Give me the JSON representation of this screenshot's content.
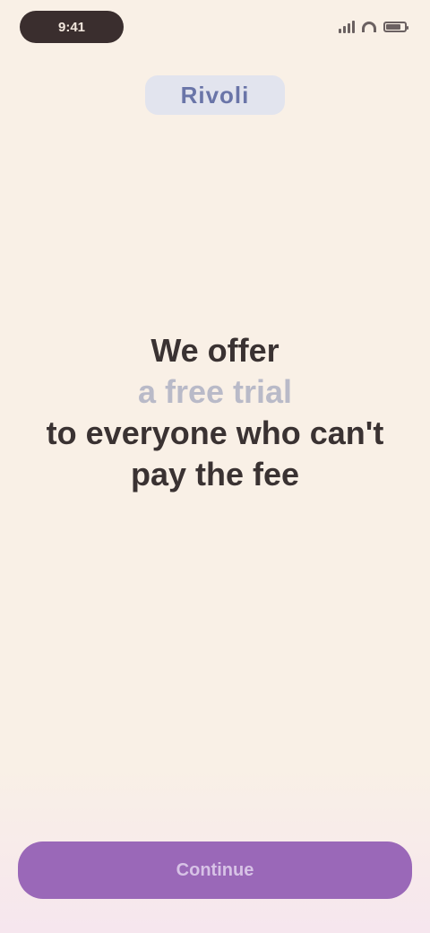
{
  "status_bar": {
    "time": "9:41",
    "icons": [
      "signal-icon",
      "wifi-icon",
      "battery-icon"
    ],
    "battery_level": 0.8
  },
  "logo": {
    "text": "Rivoli"
  },
  "message": {
    "line1": "We offer",
    "highlight": "a free trial",
    "line2": "to everyone who can't",
    "line3": "pay the fee"
  },
  "cta": {
    "label": "Continue"
  },
  "colors": {
    "background": "#f9f0e6",
    "text": "#3a3232",
    "highlight": "#b9bac8",
    "button": "#9a68b8",
    "logo_bg": "#e2e4ee",
    "logo_text": "#6a75a8"
  }
}
